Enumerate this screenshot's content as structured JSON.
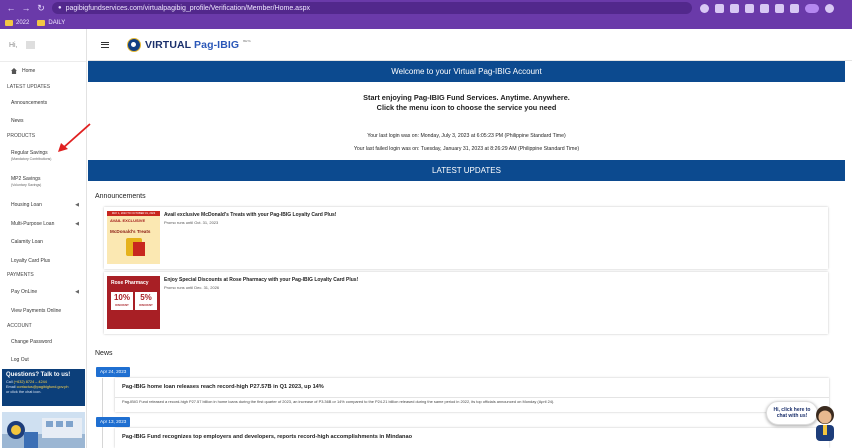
{
  "browser": {
    "url": "pagibigfundservices.com/virtualpagibig_profile/Verification/Member/Home.aspx",
    "bookmarks": [
      "2022",
      "DAILY"
    ]
  },
  "sidebar": {
    "greeting": "Hi,",
    "home": "Home",
    "sections": {
      "latest": "LATEST UPDATES",
      "products": "PRODUCTS",
      "payments": "PAYMENTS",
      "account": "ACCOUNT"
    },
    "items": {
      "announcements": "Announcements",
      "news": "News",
      "regular_savings": "Regular Savings",
      "regular_savings_sub": "(Mandatory Contributions)",
      "mp2_savings": "MP2 Savings",
      "mp2_savings_sub": "(Voluntary Savings)",
      "housing_loan": "Housing Loan",
      "multi_purpose_loan": "Multi-Purpose Loan",
      "calamity_loan": "Calamity Loan",
      "loyalty_card_plus": "Loyalty Card Plus",
      "pay_online": "Pay OnLine",
      "view_payments_online": "View Payments Online",
      "change_password": "Change Password",
      "log_out": "Log Out"
    },
    "help": {
      "title": "Questions? Talk to us!",
      "call_label": "Call",
      "call_value": "(+632) 8724 – 4244",
      "email_label": "Email",
      "email_value": "contactus@pagibigfund.gov.ph",
      "chat_line": "or click the chat icon."
    }
  },
  "header": {
    "logo_text_a": "VIRTUAL ",
    "logo_text_b": "Pag-IBIG",
    "logo_beta": "BETA"
  },
  "main": {
    "welcome": "Welcome to your Virtual Pag-IBIG Account",
    "tagline_1": "Start enjoying Pag-IBIG Fund Services. Anytime. Anywhere.",
    "tagline_2": "Click the menu icon to choose the service you need",
    "last_login": "Your last login was on: Monday, July 3, 2023 at 6:05:23 PM (Philippine Standard Time)",
    "last_failed_login": "Your last failed login was on: Tuesday, January 31, 2023 at 8:26:29 AM (Philippine Standard Time)",
    "latest_updates": "LATEST UPDATES",
    "announcements_title": "Announcements",
    "news_title": "News"
  },
  "announcements": [
    {
      "title": "Avail exclusive McDonald's Treats with your Pag-IBIG Loyalty Card Plus!",
      "sub": "Promo runs until Oct. 31, 2023",
      "img_top": "MAY 1, 2023 TO OCTOBER 31, 2023",
      "img_line1": "AVAIL EXCLUSIVE",
      "img_line2": "McDonald's Treats"
    },
    {
      "title": "Enjoy Special Discounts at Rose Pharmacy with your Pag-IBIG Loyalty Card Plus!",
      "sub": "Promo runs until Dec. 31, 2026",
      "img_brand": "Rose Pharmacy",
      "img_pct1": "10%",
      "img_pct2": "5%",
      "img_disc": "DISCOUNT"
    }
  ],
  "news": [
    {
      "date": "Apr 24, 2023",
      "title": "Pag-IBIG home loan releases reach record-high P27.57B in Q1 2023, up 14%",
      "body": "Pag-IBIG Fund released a record-high P27.57 billion in home loans during the first quarter of 2023, an increase of P3.36B or 14% compared to the P24.21 billion released during the same period in 2022, its top officials announced on Monday (April 24)."
    },
    {
      "date": "Apr 13, 2023",
      "title": "Pag-IBIG Fund recognizes top employers and developers, reports record-high accomplishments in Mindanao",
      "body": ""
    }
  ],
  "chat": {
    "line1": "Hi, click here to",
    "line2": "chat with us!"
  },
  "colors": {
    "browser_purple": "#6a3aa9",
    "banner_blue": "#0c4a8f",
    "badge_blue": "#1f6fd1",
    "annotation_red": "#e02020"
  }
}
